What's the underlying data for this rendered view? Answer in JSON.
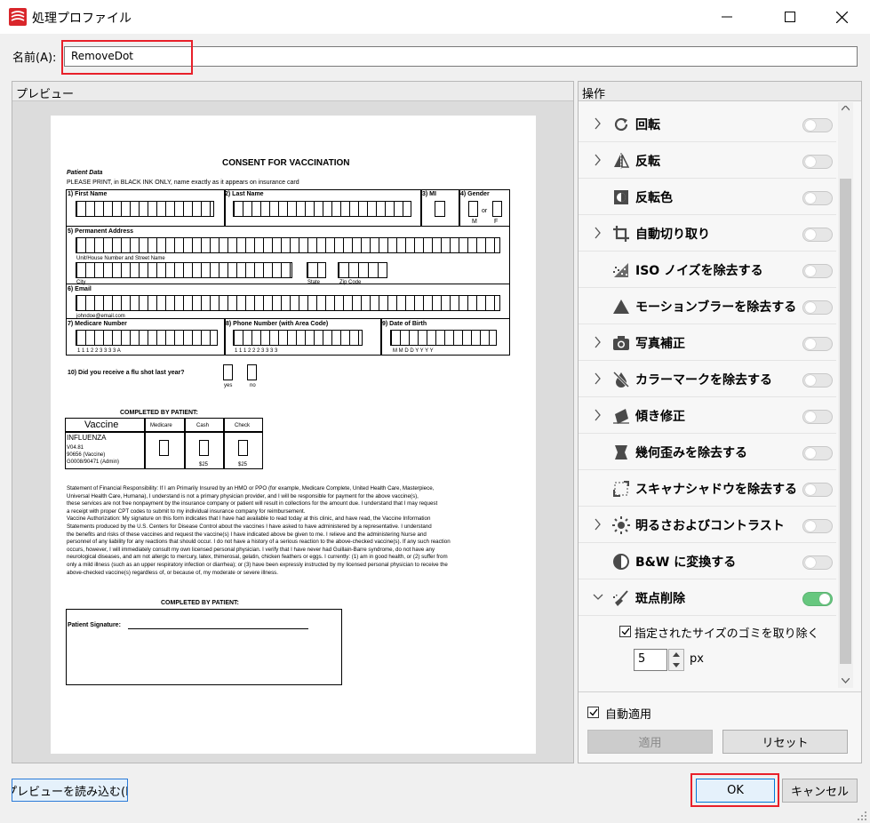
{
  "window": {
    "title": "処理プロファイル"
  },
  "name_field": {
    "label": "名前(A):",
    "value": "RemoveDot"
  },
  "preview": {
    "header": "プレビュー",
    "load_button": "プレビューを読み込む(P"
  },
  "document": {
    "title": "CONSENT FOR VACCINATION",
    "section_patient_data": "Patient Data",
    "instruction": "PLEASE PRINT, in BLACK INK ONLY, name exactly as it appears on insurance card",
    "fields": {
      "first_name": "1) First Name",
      "last_name": "2) Last Name",
      "mi": "3) MI",
      "gender": "4) Gender",
      "gender_or": "or",
      "gender_m": "M",
      "gender_f": "F",
      "address": "5) Permanent Address",
      "address_sub": "Unit/House Number and Street Name",
      "city": "City",
      "state": "State",
      "zip": "Zip Code",
      "email": "6) Email",
      "email_example": "johndoe@email.com",
      "medicare": "7) Medicare Number",
      "medicare_sample": "1  1  1        2  2          3  3  3  3       A",
      "phone": "8) Phone Number (with Area Code)",
      "phone_sample": "1  1  1        2  2  2        3  3  3  3",
      "dob": "9) Date of Birth",
      "dob_sample": "M  M      D  D      Y  Y  Y  Y",
      "flu_question": "10) Did you receive a flu shot last year?",
      "yes": "yes",
      "no": "no"
    },
    "completed_by_patient": "COMPLETED BY PATIENT:",
    "vaccine_table": {
      "headers": [
        "Vaccine",
        "Medicare",
        "Cash",
        "Check"
      ],
      "vaccine_name": "INFLUENZA",
      "codes": [
        "V04.81",
        "90656 (Vaccine)",
        "G0008/90471 (Admin)"
      ],
      "cash_price": "$25",
      "check_price": "$25"
    },
    "financial_paragraph": [
      "Statement of Financial Responsibility: If I am Primarily Insured by an HMO or PPO (for example, Medicare Complete, United Health Care, Masterpiece,",
      "Universal Health Care, Humana), I understand              is not a primary physician provider, and I will be responsible for payment for the above vaccine(s),",
      "these services are not free nonpayment by the insurance company or patient will result in collections for the amount due. I understand that I may request",
      "a receipt with proper CPT codes to submit to my individual insurance company for reimbursement.",
      "Vaccine Authorization: My signature on this form indicates that I have had available to read today at this clinic, and have read, the Vaccine Information",
      "Statements produced by the U.S. Centers for Disease Control about the vaccines I have asked to have administered by a             representative.  I understand",
      "the benefits and risks of these vaccines and request the vaccine(s) I have indicated above be given to me.  I relieve              and the administering Nurse and",
      "personnel of any liability for any reactions that should occur.  I do not have a history of a serious reaction to the above-checked vaccine(s).  If any such reaction",
      "occurs, however, I will immediately consult my own licensed personal physician.  I verify that I have never had Guillain-Barre syndrome, do not have any",
      "neurological diseases, and am not allergic to mercury, latex, thimerosal, gelatin, chicken feathers or eggs.  I currently:  (1) am in good health, or (2) suffer from",
      "only a mild illness (such as an upper respiratory infection or diarrhea); or (3) have been expressly instructed by my licensed personal physician to receive the",
      "above-checked vaccine(s) regardless of, or because of, my moderate or severe illness."
    ],
    "signature_label": "Patient Signature:"
  },
  "operations": {
    "header": "操作",
    "items": [
      {
        "label": "回転",
        "icon": "rotate-icon",
        "expandable": true,
        "enabled": false
      },
      {
        "label": "反転",
        "icon": "flip-icon",
        "expandable": true,
        "enabled": false
      },
      {
        "label": "反転色",
        "icon": "invert-color-icon",
        "expandable": false,
        "enabled": false
      },
      {
        "label": "自動切り取り",
        "icon": "crop-icon",
        "expandable": true,
        "enabled": false
      },
      {
        "label": "ISO ノイズを除去する",
        "icon": "noise-icon",
        "expandable": false,
        "enabled": false
      },
      {
        "label": "モーションブラーを除去する",
        "icon": "motion-blur-icon",
        "expandable": false,
        "enabled": false
      },
      {
        "label": "写真補正",
        "icon": "camera-icon",
        "expandable": true,
        "enabled": false
      },
      {
        "label": "カラーマークを除去する",
        "icon": "color-mark-icon",
        "expandable": true,
        "enabled": false
      },
      {
        "label": "傾き修正",
        "icon": "deskew-icon",
        "expandable": true,
        "enabled": false
      },
      {
        "label": "幾何歪みを除去する",
        "icon": "geometry-icon",
        "expandable": false,
        "enabled": false
      },
      {
        "label": "スキャナシャドウを除去する",
        "icon": "scanner-shadow-icon",
        "expandable": false,
        "enabled": false
      },
      {
        "label": "明るさおよびコントラスト",
        "icon": "brightness-icon",
        "expandable": true,
        "enabled": false
      },
      {
        "label": "B&W に変換する",
        "icon": "bw-icon",
        "expandable": false,
        "enabled": false
      },
      {
        "label": "斑点削除",
        "icon": "broom-icon",
        "expandable": true,
        "enabled": true
      }
    ],
    "despeckle": {
      "checkbox_label": "指定されたサイズのゴミを取り除く(R",
      "checked": true,
      "size_value": "5",
      "unit": "px"
    },
    "auto_apply_label": "自動適用",
    "auto_apply_checked": true,
    "apply_button": "適用",
    "reset_button": "リセット"
  },
  "footer": {
    "ok": "OK",
    "cancel": "キャンセル"
  },
  "colors": {
    "highlight": "#e8202a",
    "toggle_on": "#67c77f",
    "icon": "#4a4a4a"
  }
}
